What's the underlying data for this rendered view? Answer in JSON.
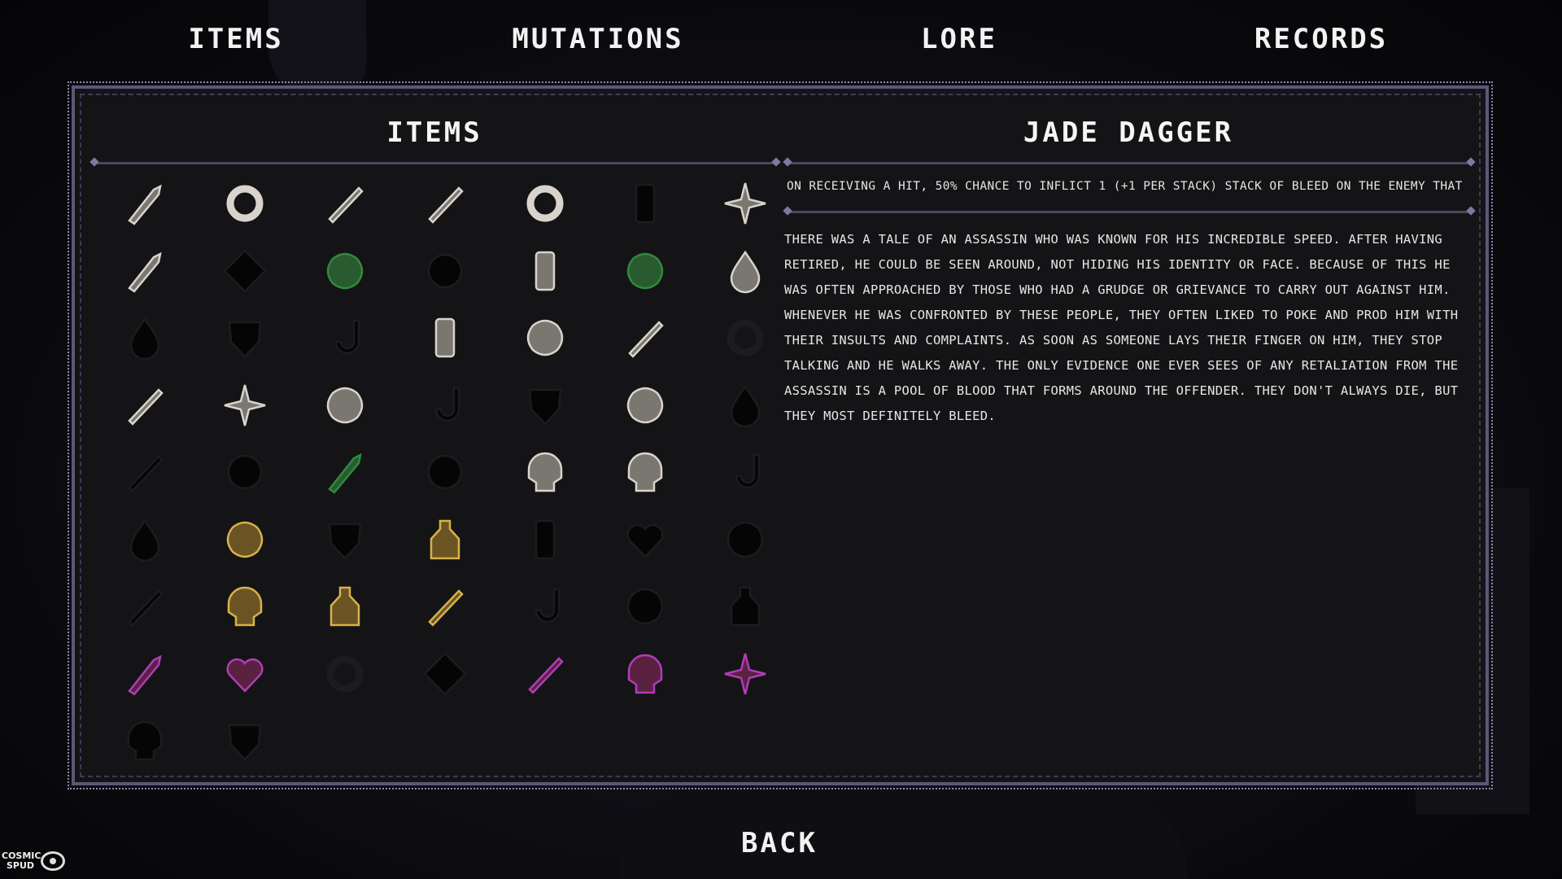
{
  "tabs": [
    {
      "label": "ITEMS"
    },
    {
      "label": "MUTATIONS"
    },
    {
      "label": "LORE"
    },
    {
      "label": "RECORDS"
    }
  ],
  "panel": {
    "left_heading": "ITEMS",
    "right_heading": "JADE DAGGER"
  },
  "detail": {
    "effect": "ON RECEIVING A HIT, 50% CHANCE TO INFLICT 1 (+1 PER STACK) STACK OF BLEED ON THE ENEMY THAT HIT YOU.",
    "lore": "THERE WAS A TALE OF AN ASSASSIN WHO WAS KNOWN FOR HIS INCREDIBLE SPEED. AFTER HAVING RETIRED, HE COULD BE SEEN AROUND, NOT HIDING HIS IDENTITY OR FACE. BECAUSE OF THIS HE WAS OFTEN APPROACHED BY THOSE WHO HAD A GRUDGE OR GRIEVANCE TO CARRY OUT AGAINST HIM. WHENEVER HE WAS CONFRONTED BY THESE PEOPLE, THEY OFTEN LIKED TO POKE AND PROD HIM WITH THEIR INSULTS AND COMPLAINTS. AS SOON AS SOMEONE LAYS THEIR FINGER ON HIM, THEY STOP TALKING AND HE WALKS AWAY. THE ONLY EVIDENCE ONE EVER SEES OF ANY RETALIATION FROM THE ASSASSIN IS A POOL OF BLOOD THAT FORMS AROUND THE OFFENDER. THEY DON'T ALWAYS DIE, BUT THEY MOST DEFINITELY BLEED."
  },
  "back_label": "BACK",
  "logo": {
    "line1": "COSMIC",
    "line2": "SPUD"
  },
  "colors": {
    "unlocked_white": "#d8d4cc",
    "unlocked_green": "#2f8a3c",
    "unlocked_gold": "#d6b24a",
    "unlocked_purple": "#b03cb8",
    "locked": "#050505",
    "panel_border": "#5a5878"
  },
  "items": [
    {
      "icon": "chainsaw-icon",
      "unlocked": true,
      "tier": "white"
    },
    {
      "icon": "amulet-icon",
      "unlocked": true,
      "tier": "white"
    },
    {
      "icon": "short-sword-icon",
      "unlocked": true,
      "tier": "white"
    },
    {
      "icon": "rifle-icon",
      "unlocked": true,
      "tier": "white"
    },
    {
      "icon": "ring-icon",
      "unlocked": true,
      "tier": "white"
    },
    {
      "icon": "stick-icon",
      "unlocked": false,
      "tier": "white"
    },
    {
      "icon": "slingshot-icon",
      "unlocked": true,
      "tier": "white"
    },
    {
      "icon": "wooden-gun-icon",
      "unlocked": true,
      "tier": "white"
    },
    {
      "icon": "tag-icon",
      "unlocked": false,
      "tier": "white"
    },
    {
      "icon": "boxing-gloves-icon",
      "unlocked": true,
      "tier": "green"
    },
    {
      "icon": "orb-icon",
      "unlocked": false,
      "tier": "white"
    },
    {
      "icon": "jar-icon",
      "unlocked": true,
      "tier": "white"
    },
    {
      "icon": "boot-icon",
      "unlocked": true,
      "tier": "green"
    },
    {
      "icon": "vial-icon",
      "unlocked": true,
      "tier": "white"
    },
    {
      "icon": "fleur-icon",
      "unlocked": false,
      "tier": "white"
    },
    {
      "icon": "shield-icon",
      "unlocked": false,
      "tier": "white"
    },
    {
      "icon": "hammer-icon",
      "unlocked": false,
      "tier": "white"
    },
    {
      "icon": "lantern-icon",
      "unlocked": true,
      "tier": "white"
    },
    {
      "icon": "stone-icon",
      "unlocked": true,
      "tier": "white"
    },
    {
      "icon": "bone-icon",
      "unlocked": true,
      "tier": "white"
    },
    {
      "icon": "donut-icon",
      "unlocked": false,
      "tier": "white"
    },
    {
      "icon": "pickaxe-icon",
      "unlocked": true,
      "tier": "white"
    },
    {
      "icon": "shuriken-icon",
      "unlocked": true,
      "tier": "white"
    },
    {
      "icon": "cat-icon",
      "unlocked": true,
      "tier": "white"
    },
    {
      "icon": "claw-icon",
      "unlocked": false,
      "tier": "white"
    },
    {
      "icon": "chalice-icon",
      "unlocked": false,
      "tier": "white"
    },
    {
      "icon": "meat-icon",
      "unlocked": true,
      "tier": "white"
    },
    {
      "icon": "paisley-icon",
      "unlocked": false,
      "tier": "white"
    },
    {
      "icon": "axe-icon",
      "unlocked": false,
      "tier": "white"
    },
    {
      "icon": "disc-icon",
      "unlocked": false,
      "tier": "white"
    },
    {
      "icon": "jade-dagger-icon",
      "unlocked": true,
      "tier": "green",
      "selected": true
    },
    {
      "icon": "blob-icon",
      "unlocked": false,
      "tier": "white"
    },
    {
      "icon": "skull-mask-icon",
      "unlocked": true,
      "tier": "white"
    },
    {
      "icon": "skull-chain-icon",
      "unlocked": true,
      "tier": "white"
    },
    {
      "icon": "snake-icon",
      "unlocked": false,
      "tier": "white"
    },
    {
      "icon": "gourd-icon",
      "unlocked": false,
      "tier": "white"
    },
    {
      "icon": "egg-icon",
      "unlocked": true,
      "tier": "gold"
    },
    {
      "icon": "beard-icon",
      "unlocked": false,
      "tier": "white"
    },
    {
      "icon": "starry-jar-icon",
      "unlocked": true,
      "tier": "gold"
    },
    {
      "icon": "tombstone-icon",
      "unlocked": false,
      "tier": "white"
    },
    {
      "icon": "heart-pendant-icon",
      "unlocked": false,
      "tier": "white"
    },
    {
      "icon": "splat-icon",
      "unlocked": false,
      "tier": "white"
    },
    {
      "icon": "sword-icon",
      "unlocked": false,
      "tier": "white"
    },
    {
      "icon": "owl-mask-icon",
      "unlocked": true,
      "tier": "gold"
    },
    {
      "icon": "poison-bottle-icon",
      "unlocked": true,
      "tier": "gold"
    },
    {
      "icon": "scepter-icon",
      "unlocked": true,
      "tier": "gold"
    },
    {
      "icon": "flail-icon",
      "unlocked": false,
      "tier": "white"
    },
    {
      "icon": "beast-icon",
      "unlocked": false,
      "tier": "white"
    },
    {
      "icon": "kettlebell-icon",
      "unlocked": false,
      "tier": "white"
    },
    {
      "icon": "serpent-sword-icon",
      "unlocked": true,
      "tier": "purple"
    },
    {
      "icon": "dark-heart-icon",
      "unlocked": true,
      "tier": "purple"
    },
    {
      "icon": "key-ring-icon",
      "unlocked": false,
      "tier": "white"
    },
    {
      "icon": "diamond-icon",
      "unlocked": false,
      "tier": "white"
    },
    {
      "icon": "spear-icon",
      "unlocked": true,
      "tier": "purple"
    },
    {
      "icon": "stone-skull-icon",
      "unlocked": true,
      "tier": "purple"
    },
    {
      "icon": "moth-icon",
      "unlocked": true,
      "tier": "purple"
    },
    {
      "icon": "demon-icon",
      "unlocked": false,
      "tier": "white"
    },
    {
      "icon": "hand-icon",
      "unlocked": false,
      "tier": "white"
    }
  ]
}
